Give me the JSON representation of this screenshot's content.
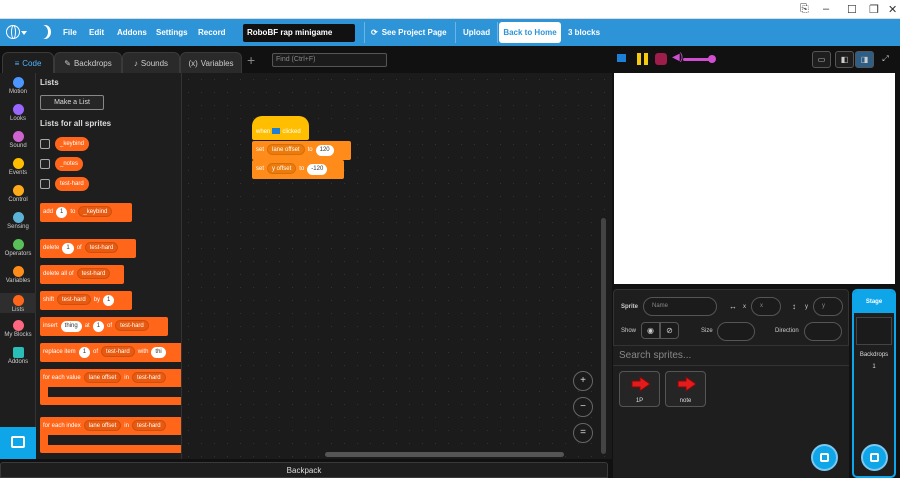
{
  "menubar": {
    "items": [
      "File",
      "Edit",
      "Addons",
      "Settings",
      "Record"
    ],
    "project_title": "RoboBF rap minigame",
    "see_project_page": "See Project Page",
    "upload": "Upload",
    "back_home": "Back to Home",
    "blocks_count": "3 blocks"
  },
  "tabs": {
    "code": "Code",
    "backdrops": "Backdrops",
    "sounds": "Sounds",
    "variables": "Variables"
  },
  "find": {
    "placeholder": "Find (Ctrl+F)"
  },
  "categories": [
    {
      "label": "Motion",
      "color": "#4c97ff"
    },
    {
      "label": "Looks",
      "color": "#9966ff"
    },
    {
      "label": "Sound",
      "color": "#cf63cf"
    },
    {
      "label": "Events",
      "color": "#ffbf00"
    },
    {
      "label": "Control",
      "color": "#ffab19"
    },
    {
      "label": "Sensing",
      "color": "#5cb1d6"
    },
    {
      "label": "Operators",
      "color": "#59c059"
    },
    {
      "label": "Variables",
      "color": "#ff8c1a"
    },
    {
      "label": "Lists",
      "color": "#ff661a"
    },
    {
      "label": "My Blocks",
      "color": "#ff6680"
    },
    {
      "label": "Addons",
      "color": "#29beb8"
    }
  ],
  "flyout": {
    "heading": "Lists",
    "make_list": "Make a List",
    "lists_all": "Lists for all sprites",
    "lists": [
      "_keybind",
      "_notes",
      "test-hard"
    ],
    "add": {
      "w1": "add",
      "v": "1",
      "w2": "to",
      "list": "_keybind"
    },
    "delete": {
      "w1": "delete",
      "v": "1",
      "w2": "of",
      "list": "test-hard"
    },
    "delete_all": {
      "w1": "delete all of",
      "list": "test-hard"
    },
    "shift": {
      "w1": "shift",
      "list": "test-hard",
      "w2": "by",
      "v": "1"
    },
    "insert": {
      "w1": "insert",
      "v": "thing",
      "w2": "at",
      "v2": "1",
      "w3": "of",
      "list": "test-hard"
    },
    "replace": {
      "w1": "replace item",
      "v": "1",
      "w2": "of",
      "list": "test-hard",
      "w3": "with",
      "v2": "thi"
    },
    "for_each_value": {
      "w1": "for each value",
      "var": "lane offset",
      "w2": "in",
      "list": "test-hard"
    },
    "for_each_index": {
      "w1": "for each index",
      "var": "lane offset",
      "w2": "in",
      "list": "test-hard"
    }
  },
  "script": {
    "hat": {
      "w1": "when",
      "w2": "clicked"
    },
    "set1": {
      "w1": "set",
      "var": "lane offset",
      "w2": "to",
      "v": "120"
    },
    "set2": {
      "w1": "set",
      "var": "y offset",
      "w2": "to",
      "v": "-120"
    }
  },
  "zoom": {
    "in": "+",
    "out": "−",
    "reset": "="
  },
  "backpack": "Backpack",
  "sprite_info": {
    "sprite_label": "Sprite",
    "name_placeholder": "Name",
    "x_label": "x",
    "x_placeholder": "x",
    "y_label": "y",
    "y_placeholder": "y",
    "show_label": "Show",
    "size_label": "Size",
    "direction_label": "Direction"
  },
  "search_sprites": "Search sprites...",
  "sprites": [
    "1P",
    "note"
  ],
  "stage_panel": {
    "title": "Stage",
    "backdrops_label": "Backdrops",
    "backdrops_count": "1"
  }
}
